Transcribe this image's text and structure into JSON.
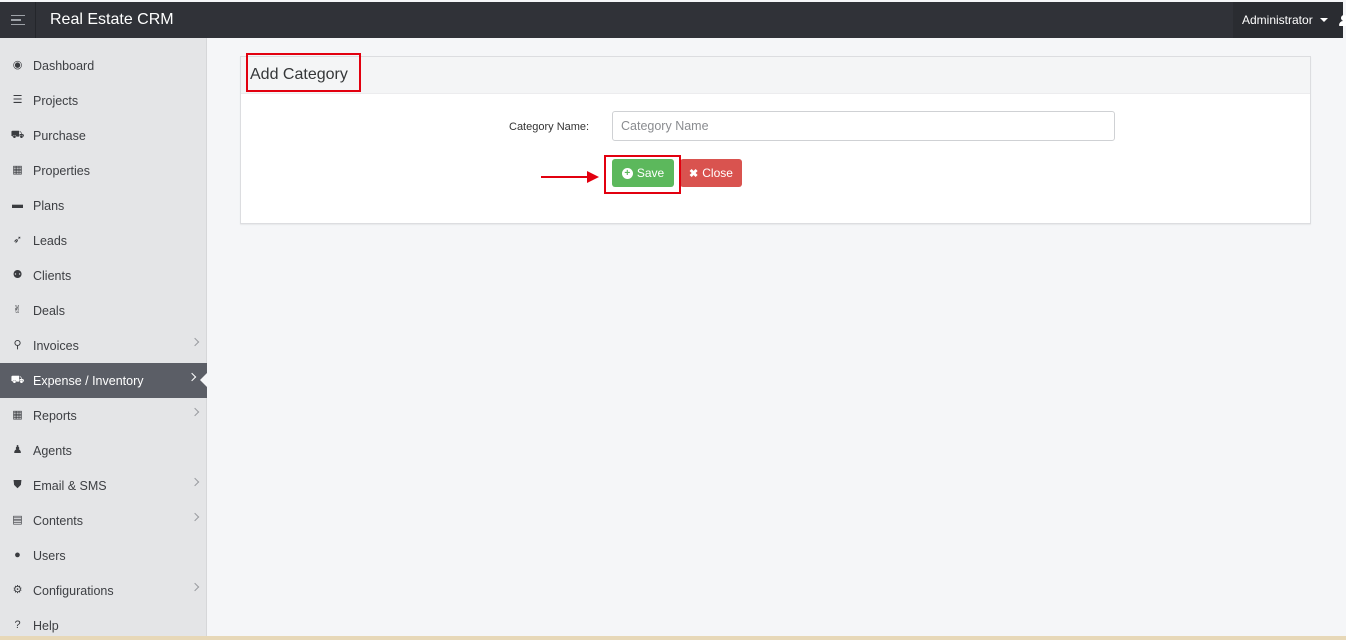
{
  "app": {
    "title": "Real Estate CRM"
  },
  "header": {
    "user_label": "Administrator"
  },
  "sidebar": {
    "items": [
      {
        "label": "Dashboard",
        "icon": "dashboard-icon",
        "glyph": "◉"
      },
      {
        "label": "Projects",
        "icon": "server-icon",
        "glyph": "☰"
      },
      {
        "label": "Purchase",
        "icon": "cart-icon",
        "glyph": "⛟"
      },
      {
        "label": "Properties",
        "icon": "building-icon",
        "glyph": "▦"
      },
      {
        "label": "Plans",
        "icon": "briefcase-icon",
        "glyph": "▬"
      },
      {
        "label": "Leads",
        "icon": "rocket-icon",
        "glyph": "➶"
      },
      {
        "label": "Clients",
        "icon": "users-icon",
        "glyph": "⚉"
      },
      {
        "label": "Deals",
        "icon": "thumbs-up-icon",
        "glyph": "✌"
      },
      {
        "label": "Invoices",
        "icon": "pin-icon",
        "glyph": "⚲",
        "submenu": true
      },
      {
        "label": "Expense / Inventory",
        "icon": "cart-icon",
        "glyph": "⛟",
        "submenu": true,
        "active": true
      },
      {
        "label": "Reports",
        "icon": "table-icon",
        "glyph": "▦",
        "submenu": true
      },
      {
        "label": "Agents",
        "icon": "user-secret-icon",
        "glyph": "♟"
      },
      {
        "label": "Email & SMS",
        "icon": "shield-icon",
        "glyph": "⛊",
        "submenu": true
      },
      {
        "label": "Contents",
        "icon": "newspaper-icon",
        "glyph": "▤",
        "submenu": true
      },
      {
        "label": "Users",
        "icon": "user-icon",
        "glyph": "●"
      },
      {
        "label": "Configurations",
        "icon": "cogs-icon",
        "glyph": "⚙",
        "submenu": true
      },
      {
        "label": "Help",
        "icon": "question-circle-icon",
        "glyph": "?"
      }
    ]
  },
  "panel": {
    "title": "Add Category",
    "form": {
      "category_label": "Category Name:",
      "category_placeholder": "Category Name",
      "category_value": ""
    },
    "buttons": {
      "save_label": "Save",
      "close_label": "Close"
    }
  },
  "colors": {
    "topbar": "#303238",
    "sidebar": "#e4e5e7",
    "active_item": "#5b5e66",
    "save": "#5cb85c",
    "close": "#d9534f",
    "annotation": "#e2000f"
  }
}
